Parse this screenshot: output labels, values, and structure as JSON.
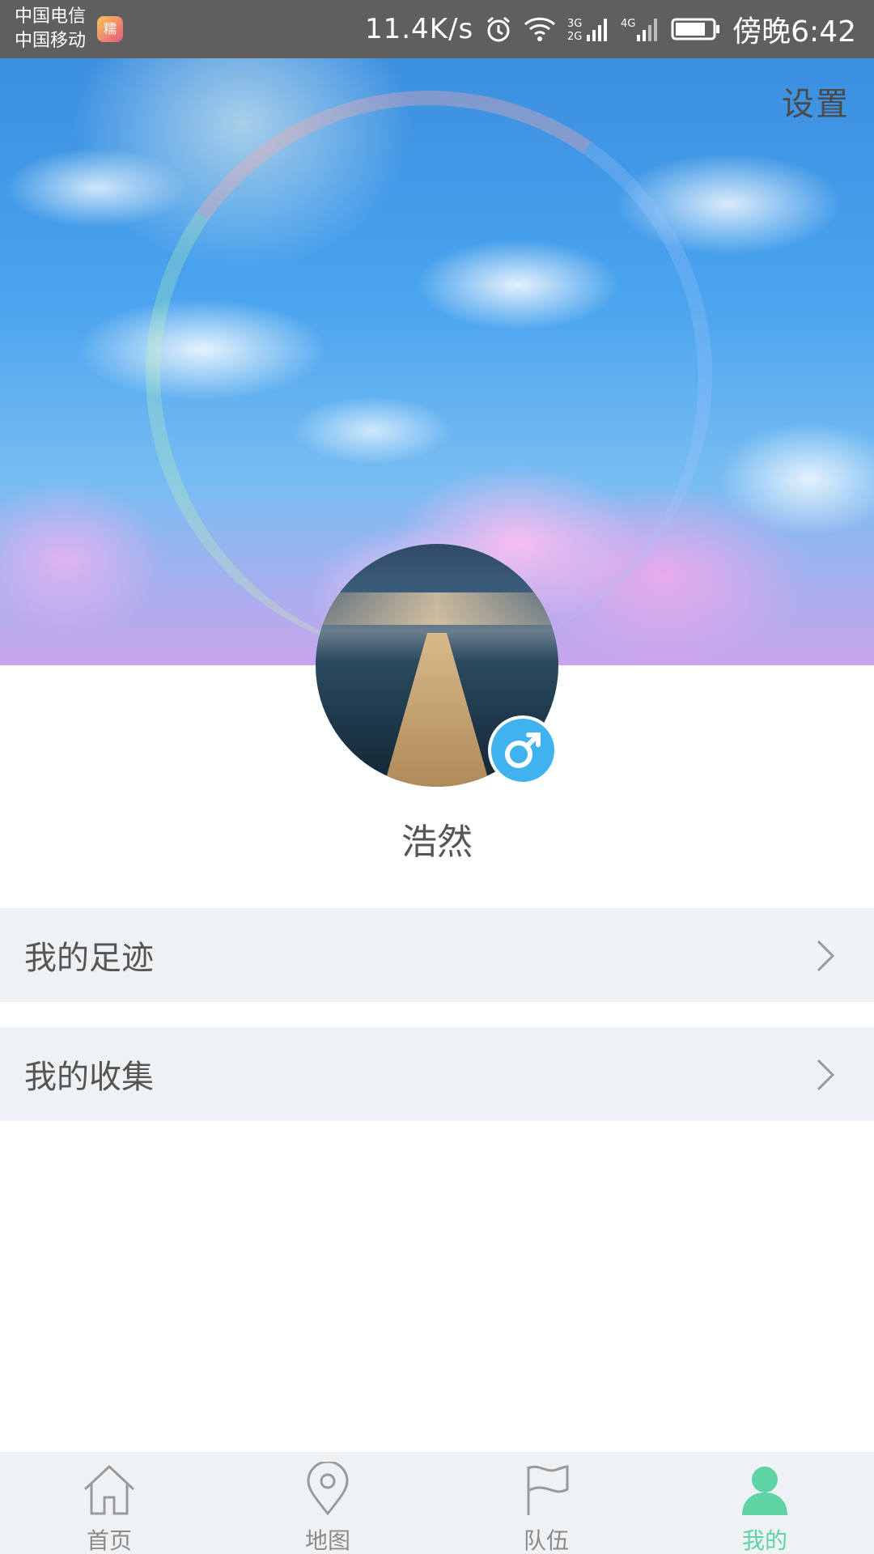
{
  "status_bar": {
    "carrier_1": "中国电信",
    "carrier_2": "中国移动",
    "app_badge": "糯",
    "network_speed": "11.4K/s",
    "time": "傍晚6:42",
    "icons": [
      "alarm-icon",
      "wifi-icon",
      "signal-3g-icon",
      "signal-4g-icon",
      "battery-icon"
    ]
  },
  "header": {
    "settings_label": "设置"
  },
  "profile": {
    "username": "浩然",
    "gender_icon": "male-icon",
    "gender_color": "#3fb2ef"
  },
  "menu": {
    "items": [
      {
        "label": "我的足迹"
      },
      {
        "label": "我的收集"
      }
    ]
  },
  "tabbar": {
    "active_color": "#5fd3a3",
    "inactive_color": "#8a8a8a",
    "tabs": [
      {
        "label": "首页",
        "icon": "home-icon"
      },
      {
        "label": "地图",
        "icon": "map-pin-icon"
      },
      {
        "label": "队伍",
        "icon": "flag-icon"
      },
      {
        "label": "我的",
        "icon": "user-icon",
        "active": true
      }
    ]
  }
}
